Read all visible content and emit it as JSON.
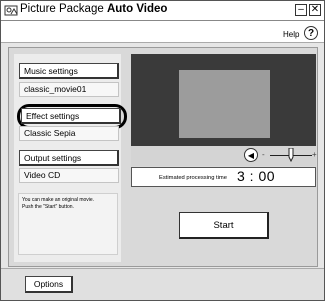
{
  "window": {
    "title_prefix": "Picture Package",
    "title_app": "Auto Video",
    "minimize_glyph": "–",
    "close_glyph": "✕",
    "help_label": "Help",
    "help_glyph": "?"
  },
  "sidebar": {
    "music_button": "Music settings",
    "music_value": "classic_movie01",
    "effect_button": "Effect settings",
    "effect_value": "Classic Sepia",
    "output_button": "Output settings",
    "output_value": "Video CD",
    "info_text_line1": "You can make an original movie.",
    "info_text_line2": "Push the \"Start\" button."
  },
  "preview": {
    "volume_minus": "-",
    "volume_plus": "+",
    "estimated_label": "Estimated processing time",
    "estimated_time": "3 : 00"
  },
  "actions": {
    "start_label": "Start",
    "options_label": "Options"
  },
  "icons": {
    "app": "picture-package-icon",
    "speaker": "speaker-icon",
    "help": "help-icon"
  }
}
